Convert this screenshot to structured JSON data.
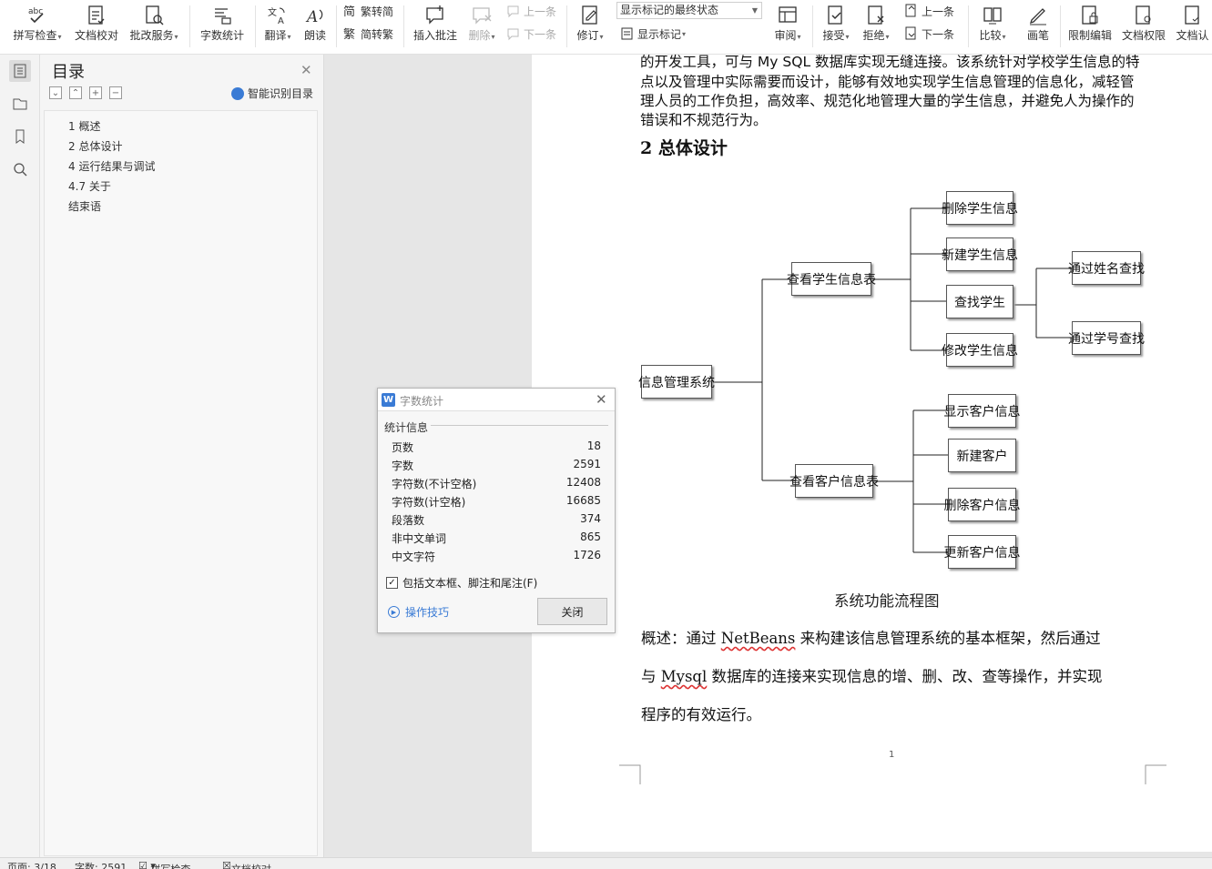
{
  "toolbar": {
    "spell_check": "拼写检查",
    "doc_proof": "文档校对",
    "revise_service": "批改服务",
    "word_count": "字数统计",
    "translate": "翻译",
    "read_aloud": "朗读",
    "trad_to_simp": "繁转简",
    "simp_to_trad": "简转繁",
    "insert_comment": "插入批注",
    "delete": "删除",
    "prev_item": "上一条",
    "next_item": "下一条",
    "markup_state": "显示标记的最终状态",
    "revise": "修订",
    "show_markup": "显示标记",
    "review": "审阅",
    "accept": "接受",
    "reject": "拒绝",
    "prev": "上一条",
    "next": "下一条",
    "compare": "比较",
    "pen": "画笔",
    "restrict_edit": "限制编辑",
    "doc_permission": "文档权限",
    "doc_cert": "文档认"
  },
  "toc": {
    "title": "目录",
    "smart_detect": "智能识别目录",
    "items": [
      "1 概述",
      "2 总体设计",
      "4 运行结果与调试",
      "4.7 关于",
      "结束语"
    ]
  },
  "document": {
    "para1": [
      "的开发工具，可与 My SQL 数据库实现无缝连接。该系统针对学校学生信息的特",
      "点以及管理中实际需要而设计，能够有效地实现学生信息管理的信息化，减轻管",
      "理人员的工作负担，高效率、规范化地管理大量的学生信息，并避免人为操作的",
      "错误和不规范行为。"
    ],
    "heading": "2 总体设计",
    "flow": {
      "root": "信息管理系统",
      "student_table": "查看学生信息表",
      "customer_table": "查看客户信息表",
      "delete_student": "删除学生信息",
      "new_student": "新建学生信息",
      "find_student": "查找学生",
      "edit_student": "修改学生信息",
      "by_name": "通过姓名查找",
      "by_id": "通过学号查找",
      "show_customer": "显示客户信息",
      "new_customer": "新建客户",
      "delete_customer": "删除客户信息",
      "update_customer": "更新客户信息"
    },
    "caption": "系统功能流程图",
    "para2": {
      "l1_a": "概述：通过 ",
      "l1_b": "NetBeans",
      "l1_c": " 来构建该信息管理系统的基本框架，然后通过",
      "l2_a": "与 ",
      "l2_b": "Mysql",
      "l2_c": " 数据库的连接来实现信息的增、删、改、查等操作，并实现",
      "l3": "程序的有效运行。"
    },
    "page_number": "1"
  },
  "dialog": {
    "title": "字数统计",
    "section": "统计信息",
    "stats": [
      {
        "label": "页数",
        "value": "18"
      },
      {
        "label": "字数",
        "value": "2591"
      },
      {
        "label": "字符数(不计空格)",
        "value": "12408"
      },
      {
        "label": "字符数(计空格)",
        "value": "16685"
      },
      {
        "label": "段落数",
        "value": "374"
      },
      {
        "label": "非中文单词",
        "value": "865"
      },
      {
        "label": "中文字符",
        "value": "1726"
      }
    ],
    "include_label": "包括文本框、脚注和尾注(F)",
    "include_checked": true,
    "tips": "操作技巧",
    "close_btn": "关闭"
  },
  "statusbar": {
    "page": "页面: 3/18",
    "words": "字数: 2591",
    "spell": "拼写检查",
    "proof": "文档校对"
  },
  "colors": {
    "accent": "#3a7bd5"
  }
}
